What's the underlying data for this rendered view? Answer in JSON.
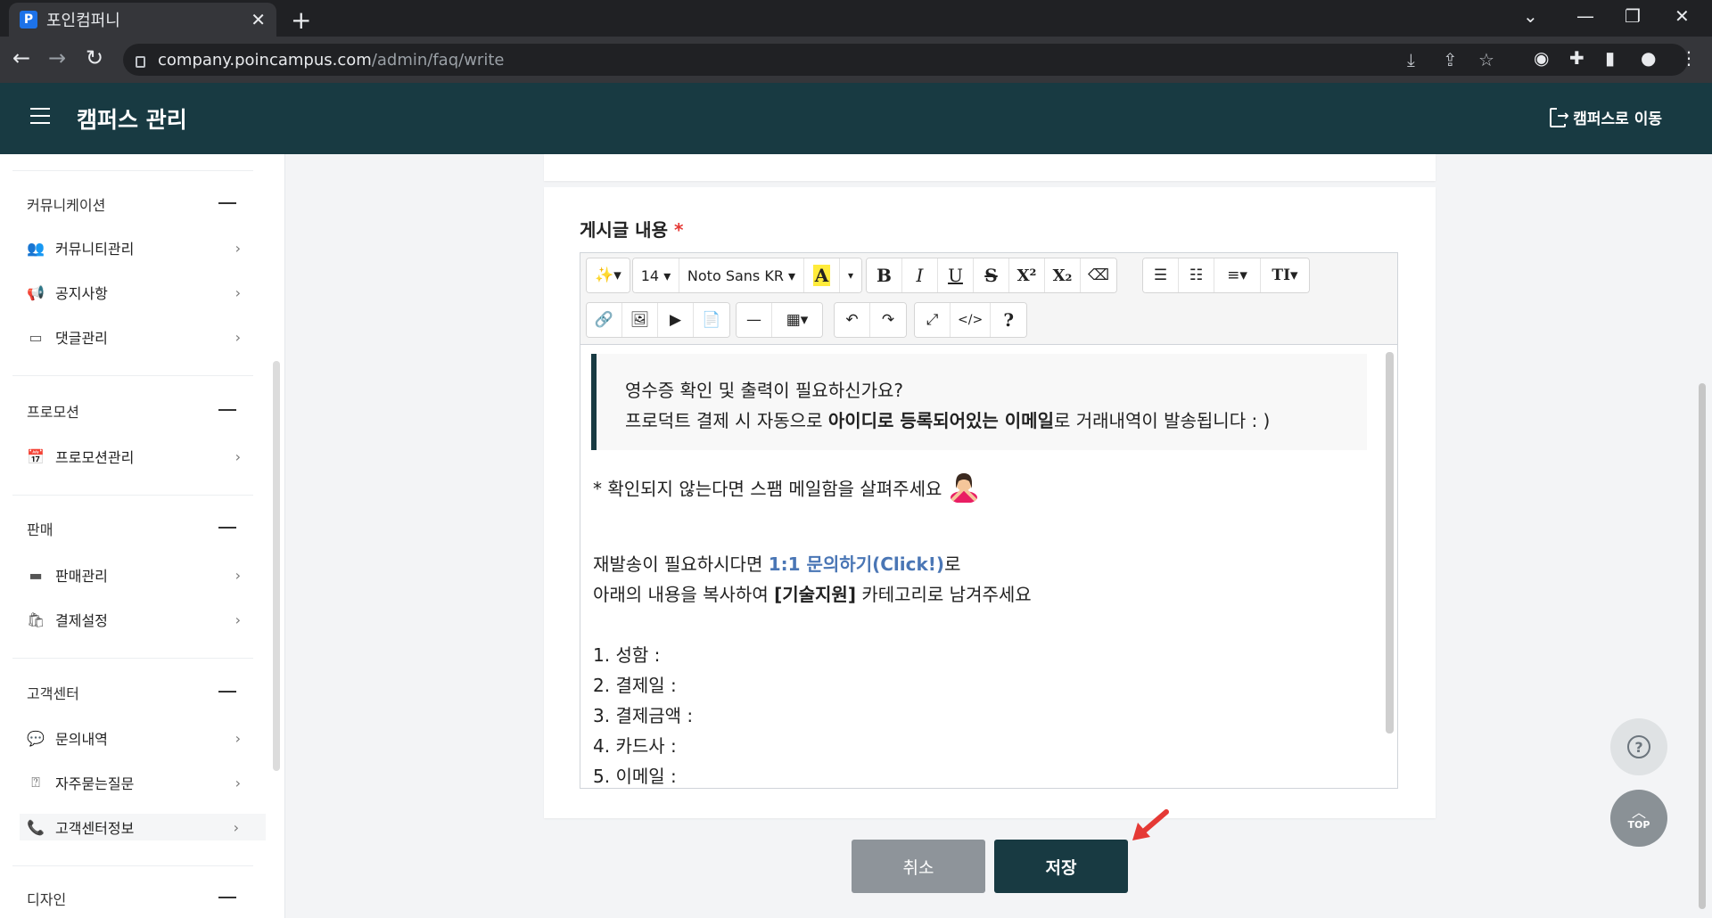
{
  "browser": {
    "tab_title": "포인컴퍼니",
    "favicon_letter": "P",
    "url_host": "company.poincampus.com",
    "url_path": "/admin/faq/write"
  },
  "header": {
    "title": "캠퍼스 관리",
    "go_campus": "캠퍼스로 이동"
  },
  "sidebar": {
    "groups": [
      {
        "title": "커뮤니케이션",
        "items": [
          {
            "label": "커뮤니티관리",
            "icon": "users-icon"
          },
          {
            "label": "공지사항",
            "icon": "megaphone-icon"
          },
          {
            "label": "댓글관리",
            "icon": "comment-icon"
          }
        ]
      },
      {
        "title": "프로모션",
        "items": [
          {
            "label": "프로모션관리",
            "icon": "calendar-icon"
          }
        ]
      },
      {
        "title": "판매",
        "items": [
          {
            "label": "판매관리",
            "icon": "card-icon"
          },
          {
            "label": "결제설정",
            "icon": "bag-icon"
          }
        ]
      },
      {
        "title": "고객센터",
        "items": [
          {
            "label": "문의내역",
            "icon": "chat-icon"
          },
          {
            "label": "자주묻는질문",
            "icon": "faq-icon"
          },
          {
            "label": "고객센터정보",
            "icon": "phone-icon"
          }
        ]
      },
      {
        "title": "디자인",
        "items": []
      }
    ]
  },
  "form": {
    "content_label": "게시글 내용",
    "required_mark": "*"
  },
  "editor": {
    "font_size": "14",
    "font_family": "Noto Sans KR",
    "toolbar_glyphs": {
      "bold": "B",
      "italic": "I",
      "underline": "U",
      "strike": "S",
      "superscript": "X²",
      "subscript": "X₂",
      "color": "A",
      "text_style": "TI",
      "code": "</>",
      "help": "?"
    },
    "content": {
      "quote_line1": "영수증 확인 및 출력이 필요하신가요?",
      "quote_line2_pre": "프로덕트 결제 시 자동으로 ",
      "quote_line2_bold": "아이디로 등록되어있는 이메일",
      "quote_line2_post": "로 거래내역이 발송됩니다 : )",
      "spam_note": "* 확인되지 않는다면 스팸 메일함을 살펴주세요",
      "resend_pre": "재발송이 필요하시다면 ",
      "resend_link": "1:1 문의하기(Click!)",
      "resend_post": "로",
      "copy_pre": "아래의 내용을 복사하여 ",
      "copy_bold": "[기술지원]",
      "copy_post": " 카테고리로 남겨주세요",
      "list": [
        "1. 성함 :",
        "2. 결제일 :",
        "3. 결제금액 :",
        "4. 카드사 :",
        "5. 이메일 :"
      ]
    }
  },
  "actions": {
    "cancel": "취소",
    "save": "저장"
  },
  "fab": {
    "top_label": "TOP"
  },
  "colors": {
    "header_bg": "#183a42",
    "link": "#4a76b5",
    "required": "#e53935",
    "arrow": "#e53935"
  }
}
